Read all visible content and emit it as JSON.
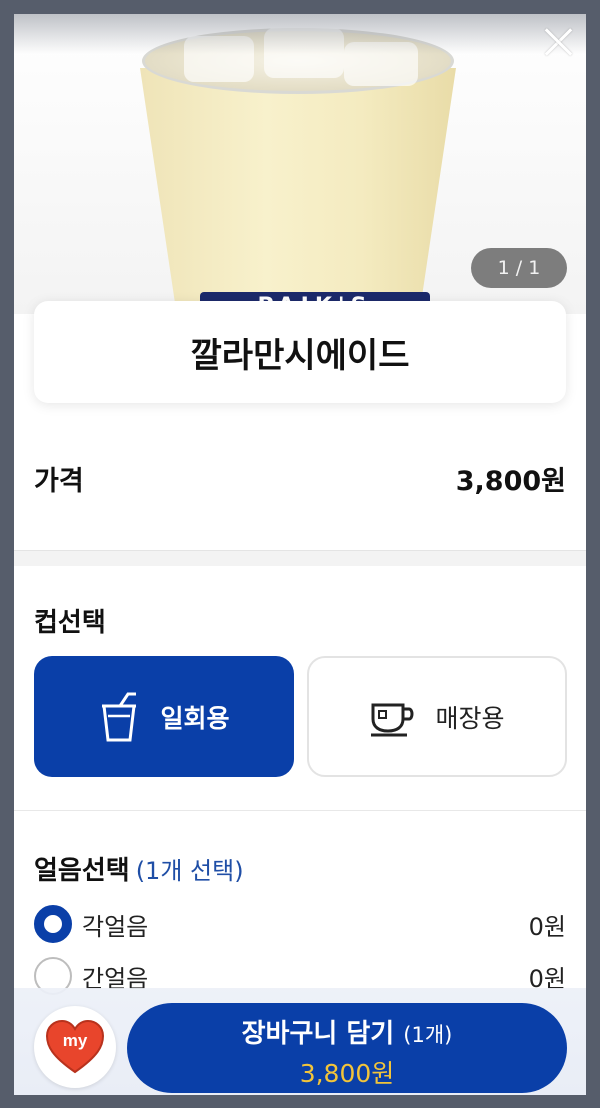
{
  "product": {
    "image_pager": "1 / 1",
    "name": "깔라만시에이드",
    "price_label": "가격",
    "price_value": "3,800원",
    "cup_logo_text": "PAIK'S"
  },
  "cup_select": {
    "title": "컵선택",
    "options": [
      {
        "label": "일회용",
        "icon": "disposable-cup-icon",
        "selected": true
      },
      {
        "label": "매장용",
        "icon": "mug-icon",
        "selected": false
      }
    ]
  },
  "ice_select": {
    "title": "얼음선택",
    "subtitle": "(1개 선택)",
    "options": [
      {
        "label": "각얼음",
        "price": "0원",
        "checked": true
      },
      {
        "label": "간얼음",
        "price": "0원",
        "checked": false
      }
    ]
  },
  "bottom": {
    "my_label": "my",
    "cart_label": "장바구니 담기",
    "cart_qty": "(1개)",
    "cart_price": "3,800원"
  },
  "colors": {
    "primary": "#0a3fa8",
    "price_accent": "#f2c43a",
    "heart": "#e8452c",
    "subtitle_blue": "#1f4ea6"
  }
}
